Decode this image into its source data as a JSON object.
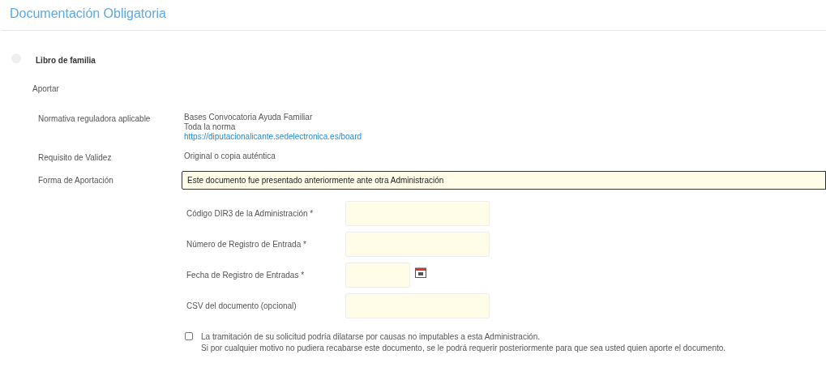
{
  "title": "Documentación Obligatoria",
  "document": {
    "name": "Libro de familia",
    "selected": false
  },
  "section": "Aportar",
  "info_rows": [
    {
      "label": "Normativa reguladora aplicable",
      "lines": [
        {
          "kind": "text",
          "text": "Bases Convocatoria Ayuda Familiar"
        },
        {
          "kind": "text",
          "text": "Toda la norma"
        },
        {
          "kind": "link",
          "text": "https://diputacionalicante.sedelectronica.es/board"
        }
      ]
    },
    {
      "label": "Requisito de Validez",
      "lines": [
        {
          "kind": "text",
          "text": "Original o copia auténtica"
        }
      ]
    }
  ],
  "forma": {
    "label": "Forma de Aportación",
    "value": "Este documento fue presentado anteriormente ante otra Administración"
  },
  "fields": [
    {
      "label": "Código DIR3 de la Administración *",
      "kind": "text"
    },
    {
      "label": "Número de Registro de Entrada *",
      "kind": "text"
    },
    {
      "label": "Fecha de Registro de Entradas *",
      "kind": "date"
    },
    {
      "label": "CSV del documento (opcional)",
      "kind": "text"
    }
  ],
  "notice": {
    "checked": false,
    "lines": [
      "La tramitación de su solicitud podría dilatarse por causas no imputables a esta Administración.",
      "Si por cualquier motivo no pudiera recabarse este documento, se le podrá requerir posteriormente para que sea usted quien aporte el documento."
    ]
  }
}
